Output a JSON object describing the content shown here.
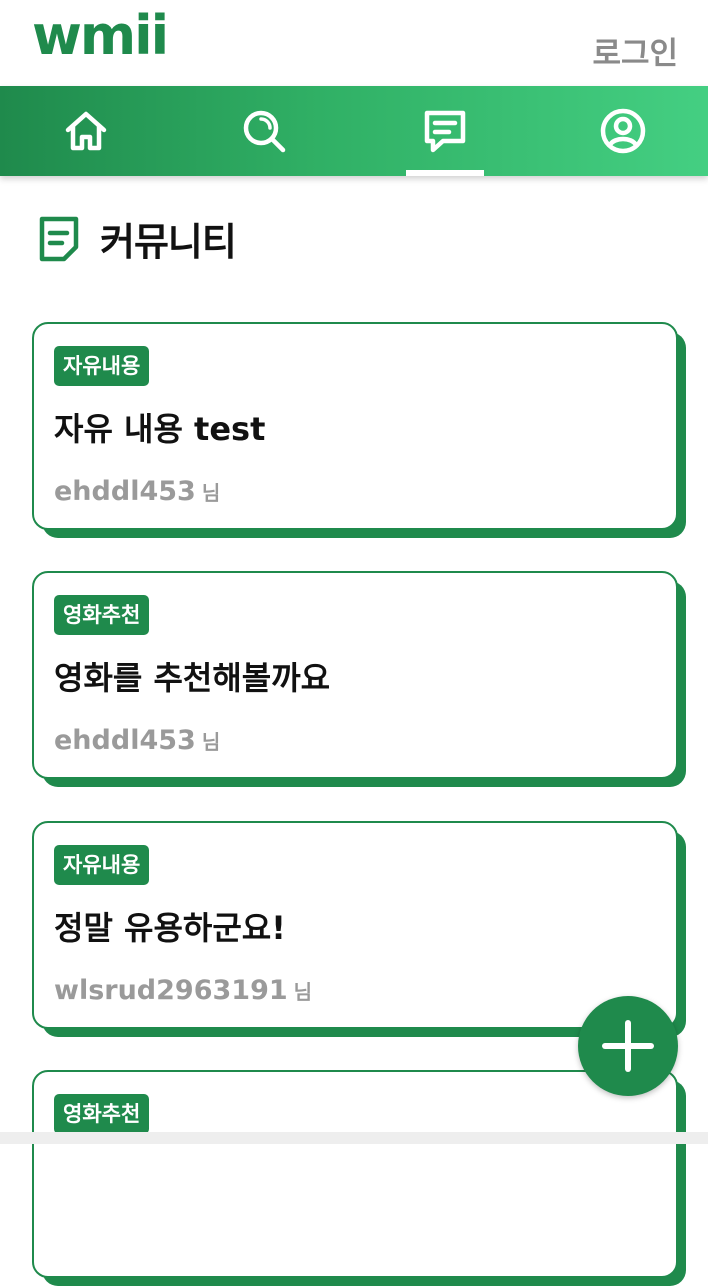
{
  "header": {
    "logo": "wmii",
    "login_label": "로그인"
  },
  "nav": {
    "items": [
      {
        "icon": "home-icon",
        "active": false
      },
      {
        "icon": "search-icon",
        "active": false
      },
      {
        "icon": "community-icon",
        "active": true
      },
      {
        "icon": "profile-icon",
        "active": false
      }
    ]
  },
  "page": {
    "title": "커뮤니티",
    "icon": "community-note-icon"
  },
  "posts": [
    {
      "category": "자유내용",
      "title": "자유 내용 test",
      "author": "ehddl453",
      "author_suffix": "님"
    },
    {
      "category": "영화추천",
      "title": "영화를 추천해볼까요",
      "author": "ehddl453",
      "author_suffix": "님"
    },
    {
      "category": "자유내용",
      "title": "정말 유용하군요!",
      "author": "wlsrud2963191",
      "author_suffix": "님"
    },
    {
      "category": "영화추천",
      "title": "",
      "author": "",
      "author_suffix": ""
    }
  ],
  "fab": {
    "icon": "plus-icon"
  },
  "colors": {
    "brand": "#1f8a4c",
    "nav_gradient_end": "#44cf82",
    "muted_text": "#9a9a9a"
  }
}
